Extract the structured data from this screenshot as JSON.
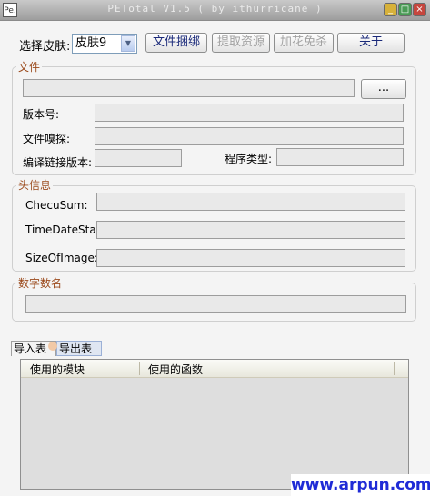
{
  "titlebar": {
    "app_icon": "Pe.",
    "title": "PETotal V1.5 ( by ithurricane )",
    "minimize": "_",
    "maximize": "□",
    "close": "×"
  },
  "toolbar": {
    "skin_label": "选择皮肤:",
    "skin_value": "皮肤9",
    "bundle_button": "文件捆绑",
    "extract_button": "提取资源",
    "shell_button": "加花免杀",
    "about_button": "关于"
  },
  "file_group": {
    "title": "文件",
    "browse_button": "...",
    "version_label": "版本号:",
    "sniff_label": "文件嗅探:",
    "linker_label": "编译链接版本:",
    "program_type_label": "程序类型:"
  },
  "header_group": {
    "title": "头信息",
    "checksum_label": "ChecuSum:",
    "timestamp_label": "TimeDateStamp:",
    "size_label": "SizeOfImage:"
  },
  "signature_group": {
    "title": "数字数名"
  },
  "tabs": {
    "import_tab": "导入表",
    "export_tab": "导出表"
  },
  "import_table": {
    "columns": [
      "使用的模块",
      "使用的函数"
    ]
  },
  "watermark": "www.arpun.com",
  "colors": {
    "group_title": "#9b4a1c",
    "button_text": "#1b2a7a",
    "disabled_text": "#a2a2a2",
    "watermark": "#1f2bd6"
  },
  "icons": {
    "dropdown": "chevron-down-icon",
    "minimize": "minimize-icon",
    "maximize": "maximize-icon",
    "close": "close-icon"
  }
}
